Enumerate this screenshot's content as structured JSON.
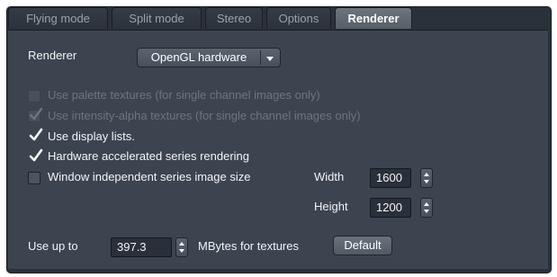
{
  "tabs": [
    {
      "label": "Flying mode",
      "active": false
    },
    {
      "label": "Split mode",
      "active": false
    },
    {
      "label": "Stereo",
      "active": false
    },
    {
      "label": "Options",
      "active": false
    },
    {
      "label": "Renderer",
      "active": true
    }
  ],
  "renderer": {
    "label": "Renderer",
    "selected": "OpenGL hardware",
    "dropdown_icon": "chevron-down-icon"
  },
  "options": [
    {
      "label": "Use palette textures (for single channel images only)",
      "checked": false,
      "enabled": false
    },
    {
      "label": "Use intensity-alpha textures (for single channel images only)",
      "checked": true,
      "enabled": false
    },
    {
      "label": "Use display lists.",
      "checked": true,
      "enabled": true
    },
    {
      "label": "Hardware accelerated series rendering",
      "checked": true,
      "enabled": true
    },
    {
      "label": "Window independent series image size",
      "checked": false,
      "enabled": true
    }
  ],
  "size": {
    "width_label": "Width",
    "width_value": "1600",
    "height_label": "Height",
    "height_value": "1200"
  },
  "textures": {
    "prefix": "Use up to",
    "value": "397.3",
    "suffix": "MBytes for textures",
    "default_button": "Default"
  },
  "colors": {
    "panel": "#3c4450",
    "frame": "#2b313a",
    "active_tab": "#5f6771",
    "text": "#f2f4f6",
    "disabled_text": "#6d7580"
  }
}
